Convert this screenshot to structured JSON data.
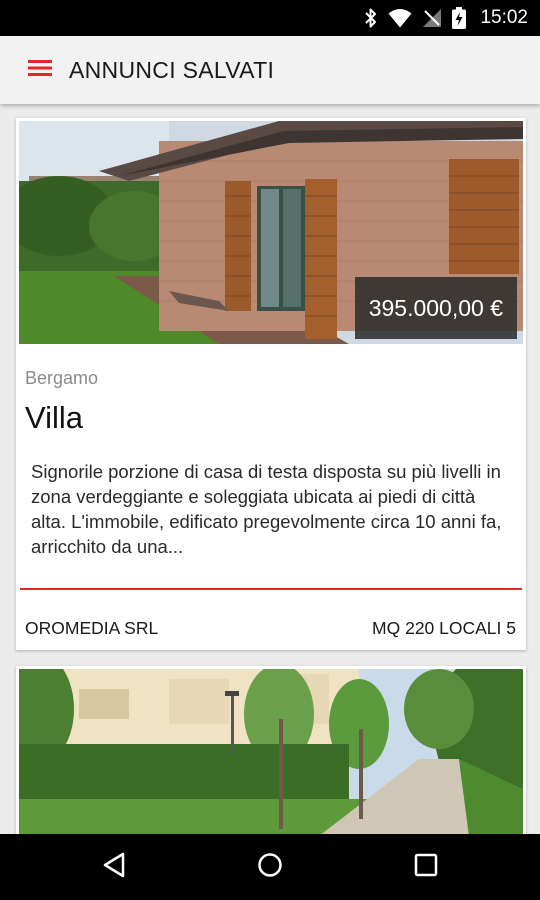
{
  "status_bar": {
    "time": "15:02",
    "icons": [
      "bluetooth-icon",
      "wifi-icon",
      "no-signal-icon",
      "battery-charging-icon"
    ]
  },
  "app_bar": {
    "menu_icon": "hamburger-menu-icon",
    "title": "ANNUNCI SALVATI"
  },
  "colors": {
    "accent": "#e4262a",
    "app_bar_bg": "#f2f2f2",
    "background": "#ececec"
  },
  "listings": [
    {
      "price": "395.000,00 €",
      "location": "Bergamo",
      "type": "Villa",
      "description": "Signorile porzione di casa di testa disposta su più livelli in zona verdeggiante e soleggiata ubicata ai piedi di città alta. L'immobile, edificato pregevolmente circa 10 anni fa, arricchito da una...",
      "agency": "OROMEDIA SRL",
      "specs": "MQ 220 LOCALI 5"
    }
  ],
  "nav_bar": {
    "icons": [
      "back-icon",
      "home-icon",
      "recent-apps-icon"
    ]
  }
}
